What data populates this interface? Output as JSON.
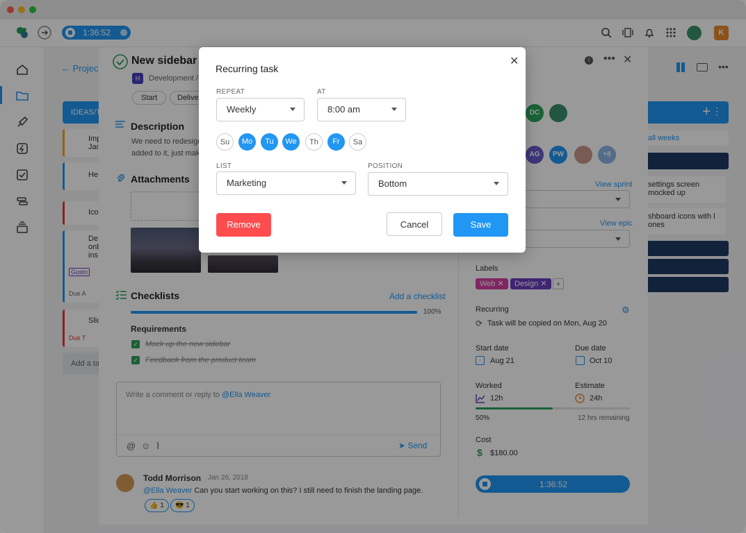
{
  "timer": {
    "value": "1:36:52"
  },
  "user_initial": "K",
  "board": {
    "back_label": "Projec",
    "column_header": "IDEAS/TA",
    "add_task": "Add a ta",
    "week_link": "all weeks",
    "right_cards": [
      "settings screen mocked up",
      "shboard icons with l ones"
    ],
    "cards": [
      {
        "text": "Imp Jan",
        "accent": "#f5a623"
      },
      {
        "text": "He",
        "accent": "#2196f3"
      },
      {
        "text": "Ico",
        "accent": "#e53935"
      },
      {
        "text": "De onb ins",
        "accent": "#2196f3",
        "tag": "Gusto",
        "due": "Due A"
      },
      {
        "text": "Slic",
        "accent": "#e53935",
        "due": "Due T"
      }
    ]
  },
  "task": {
    "title": "New sidebar d",
    "breadcrumb_badge": "H",
    "breadcrumb": "Development / I",
    "chip_start": "Start",
    "chip_deliver": "Deliver",
    "description_title": "Description",
    "description_text_1": "We need to redesign",
    "description_text_2": "added to it, just mak",
    "attachments_title": "Attachments",
    "checklists_title": "Checklists",
    "add_checklist": "Add a checklist",
    "progress_label": "100%",
    "progress": 1.0,
    "requirements_title": "Requirements",
    "checklist_items": [
      "Mock up the new sidebar",
      "Feedback from the product team"
    ],
    "comment_placeholder": "Write a comment or reply to ",
    "comment_mention": "@Ella Weaver",
    "send_label": "Send",
    "comment": {
      "author": "Todd Morrison",
      "date": "Jan 26, 2018",
      "mention": "@Ella Weaver",
      "text": " Can you start working on this? I still need to finish the landing page.",
      "reactions": [
        {
          "emoji": "👍",
          "count": "1"
        },
        {
          "emoji": "😎",
          "count": "1"
        }
      ]
    }
  },
  "side": {
    "avatars_top": [
      "DC"
    ],
    "avatars_mid": [
      "AG",
      "PW",
      "+8"
    ],
    "view_sprint": "View sprint",
    "view_epic": "View epic",
    "labels_title": "Labels",
    "labels": [
      {
        "name": "Web",
        "color": "#d63fa4"
      },
      {
        "name": "Design",
        "color": "#6a3fbf"
      }
    ],
    "recurring_title": "Recurring",
    "recurring_text": "Task will be copied on Mon, Aug 20",
    "start_title": "Start date",
    "start_value": "Aug 21",
    "due_title": "Due date",
    "due_value": "Oct 10",
    "worked_title": "Worked",
    "worked_value": "12h",
    "estimate_title": "Estimate",
    "estimate_value": "24h",
    "worked_percent": "50%",
    "worked_fraction": 0.5,
    "remaining": "12 hrs remaining",
    "cost_title": "Cost",
    "cost_value": "$180.00",
    "timer": "1:36:52"
  },
  "modal": {
    "title": "Recurring task",
    "repeat_label": "REPEAT",
    "repeat_value": "Weekly",
    "at_label": "AT",
    "at_value": "8:00 am",
    "days": [
      {
        "label": "Su",
        "on": false
      },
      {
        "label": "Mo",
        "on": true
      },
      {
        "label": "Tu",
        "on": true
      },
      {
        "label": "We",
        "on": true
      },
      {
        "label": "Th",
        "on": false
      },
      {
        "label": "Fr",
        "on": true
      },
      {
        "label": "Sa",
        "on": false
      }
    ],
    "list_label": "LIST",
    "list_value": "Marketing",
    "position_label": "POSITION",
    "position_value": "Bottom",
    "remove_label": "Remove",
    "cancel_label": "Cancel",
    "save_label": "Save"
  },
  "colors": {
    "accent": "#2196f3",
    "danger": "#ff4d4f",
    "progress_green": "#2e9e5b",
    "dark_blue": "#1f3a63"
  }
}
